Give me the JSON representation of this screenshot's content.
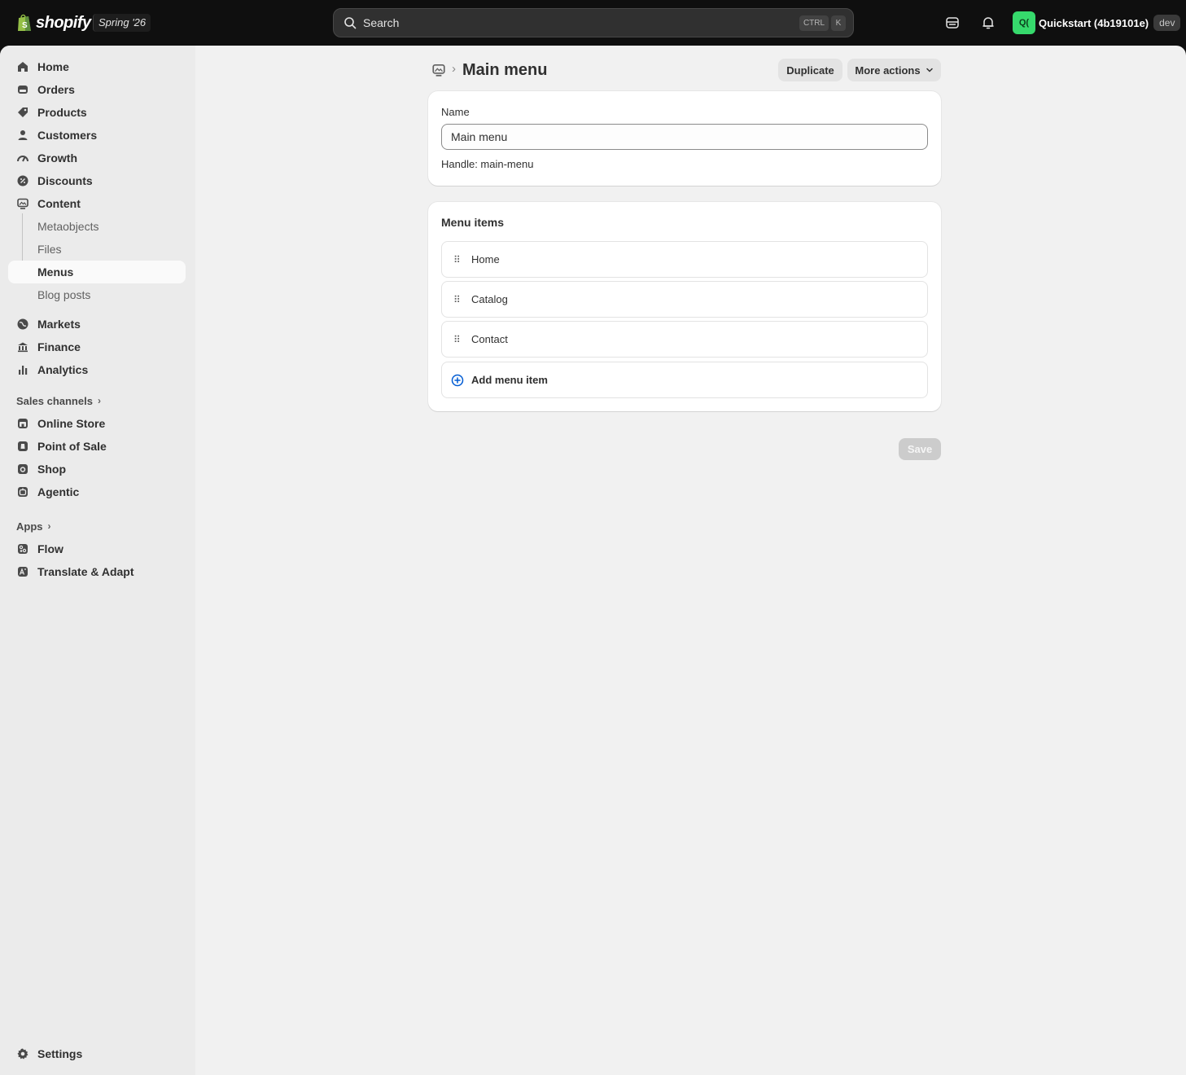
{
  "topbar": {
    "brand": "shopify",
    "edition": "Spring '26",
    "search_placeholder": "Search",
    "shortcut_ctrl": "CTRL",
    "shortcut_key": "K",
    "avatar_initials": "Q(",
    "store_name": "Quickstart (4b19101e)",
    "env_badge": "dev"
  },
  "sidebar": {
    "home": "Home",
    "orders": "Orders",
    "products": "Products",
    "customers": "Customers",
    "growth": "Growth",
    "discounts": "Discounts",
    "content": "Content",
    "content_sub": {
      "metaobjects": "Metaobjects",
      "files": "Files",
      "menus": "Menus",
      "blog_posts": "Blog posts"
    },
    "markets": "Markets",
    "finance": "Finance",
    "analytics": "Analytics",
    "sales_channels_heading": "Sales channels",
    "online_store": "Online Store",
    "point_of_sale": "Point of Sale",
    "shop": "Shop",
    "agentic": "Agentic",
    "apps_heading": "Apps",
    "flow": "Flow",
    "translate_adapt": "Translate & Adapt",
    "settings": "Settings"
  },
  "page": {
    "title": "Main menu",
    "duplicate_label": "Duplicate",
    "more_actions_label": "More actions",
    "name_label": "Name",
    "name_value": "Main menu",
    "handle_text": "Handle: main-menu",
    "menu_items_title": "Menu items",
    "menu_items": [
      {
        "label": "Home"
      },
      {
        "label": "Catalog"
      },
      {
        "label": "Contact"
      }
    ],
    "add_item_label": "Add menu item",
    "save_label": "Save"
  },
  "colors": {
    "topbar_bg": "#0f0f0f",
    "frame_bg": "#f1f1f1",
    "sidebar_bg": "#ebebeb",
    "avatar_bg": "#36d96c",
    "add_icon": "#005bd3",
    "save_disabled_bg": "#cccccc"
  }
}
